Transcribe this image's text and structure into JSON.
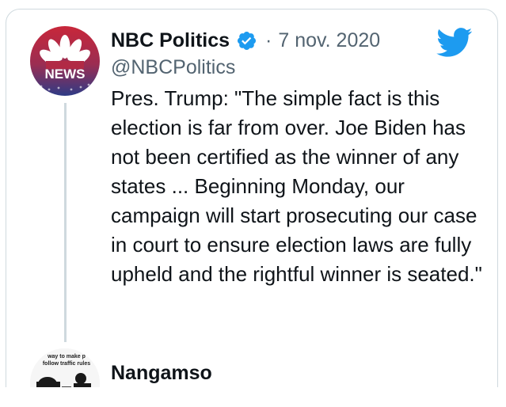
{
  "tweet": {
    "author_name": "NBC Politics",
    "handle": "@NBCPolitics",
    "separator": "·",
    "date": "7 nov. 2020",
    "avatar_text": "NEWS",
    "text": "Pres. Trump: \"The simple fact is this election is far from over. Joe Biden has not been certified as the winner of any states ... Beginning Monday, our campaign will start prosecuting our case in court to ensure election laws are fully upheld and the rightful winner is seated.\""
  },
  "reply": {
    "author_name": "Nangamso",
    "avatar_caption_line1": "way to make p",
    "avatar_caption_line2": "follow traffic rules"
  },
  "icons": {
    "verified": "verified-badge-icon",
    "platform": "twitter-bird-icon"
  },
  "colors": {
    "brand_blue": "#1d9bf0",
    "text_primary": "#0f1419",
    "text_secondary": "#536471",
    "border": "#cfd9de"
  }
}
